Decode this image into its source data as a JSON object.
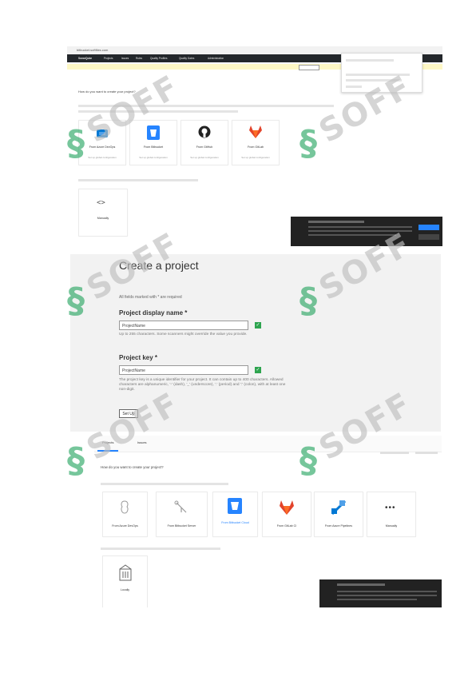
{
  "shot1": {
    "url": "bitbucket.softfiles.com",
    "nav": [
      "SonarQube",
      "Projects",
      "Issues",
      "Rules",
      "Quality Profiles",
      "Quality Gates",
      "Administration"
    ],
    "banner_text": "",
    "banner_button": "",
    "intro": "How do you want to create your project?",
    "cards": [
      {
        "label": "From Azure DevOps",
        "sub": "Set up global configuration",
        "icon": "azure-devops-icon"
      },
      {
        "label": "From Bitbucket",
        "sub": "Set up global configuration",
        "icon": "bitbucket-icon"
      },
      {
        "label": "From GitHub",
        "sub": "Set up global configuration",
        "icon": "github-icon"
      },
      {
        "label": "From GitLab",
        "sub": "Set up global configuration",
        "icon": "gitlab-icon"
      }
    ],
    "manual_intro": "",
    "manual_label": "Manually",
    "dropdown_items": [
      "",
      "",
      ""
    ],
    "notice_title": "",
    "notice_button": ""
  },
  "shot2": {
    "title": "Create a project",
    "note": "All fields marked with * are required",
    "display_name_label": "Project display name *",
    "display_name_value": "ProjectName",
    "display_name_help": "Up to 255 characters. Some scanners might override the value you provide.",
    "key_label": "Project key *",
    "key_value": "ProjectName",
    "key_help": "The project key is a unique identifier for your project. It can contain up to 400 characters. Allowed characters are alphanumeric, '-' (dash), '_' (underscore), '.' (period) and ':' (colon), with at least one non-digit.",
    "setup_button": "Set Up"
  },
  "shot3": {
    "tabs": [
      "Projects",
      "Issues"
    ],
    "intro": "How do you want to create your project?",
    "sub_intro": "",
    "cards": [
      {
        "label": "From Azure DevOps",
        "icon": "azure-devops-icon"
      },
      {
        "label": "From Bitbucket Server",
        "icon": "bitbucket-server-icon"
      },
      {
        "label": "From Bitbucket Cloud",
        "icon": "bitbucket-cloud-icon"
      },
      {
        "label": "From GitLab CI",
        "icon": "gitlab-icon"
      },
      {
        "label": "From Azure Pipelines",
        "icon": "azure-pipelines-icon"
      },
      {
        "label": "Manually",
        "icon": "more-icon"
      }
    ],
    "other_intro": "",
    "other_label": "Locally",
    "notice_title": ""
  },
  "watermark": "SOFF",
  "colors": {
    "navbar": "#23272b",
    "accent": "#2ea866",
    "gitlab": "#e2432a",
    "bitbucket": "#2684ff",
    "azure": "#0078d4"
  }
}
